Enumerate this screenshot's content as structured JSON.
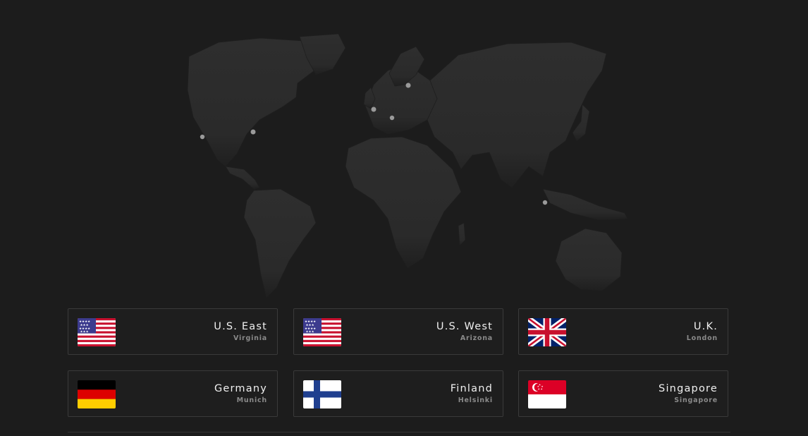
{
  "map": {
    "land_color": "#2b2b2b",
    "border_color": "#202020",
    "marker_color": "#9a9a9a",
    "markers": [
      {
        "name": "marker-us-east"
      },
      {
        "name": "marker-us-west"
      },
      {
        "name": "marker-uk"
      },
      {
        "name": "marker-germany"
      },
      {
        "name": "marker-finland"
      },
      {
        "name": "marker-singapore"
      }
    ]
  },
  "locations": [
    {
      "id": "us-east",
      "name": "U.S. East",
      "city": "Virginia",
      "flag": "us-flag-icon"
    },
    {
      "id": "us-west",
      "name": "U.S. West",
      "city": "Arizona",
      "flag": "us-flag-icon"
    },
    {
      "id": "uk",
      "name": "U.K.",
      "city": "London",
      "flag": "uk-flag-icon"
    },
    {
      "id": "germany",
      "name": "Germany",
      "city": "Munich",
      "flag": "germany-flag-icon"
    },
    {
      "id": "finland",
      "name": "Finland",
      "city": "Helsinki",
      "flag": "finland-flag-icon"
    },
    {
      "id": "singapore",
      "name": "Singapore",
      "city": "Singapore",
      "flag": "singapore-flag-icon"
    }
  ],
  "colors": {
    "background": "#1c1c1c",
    "card_border": "#3a3a3a",
    "title": "#f0f0f0",
    "subtitle": "#8a8a8a"
  }
}
